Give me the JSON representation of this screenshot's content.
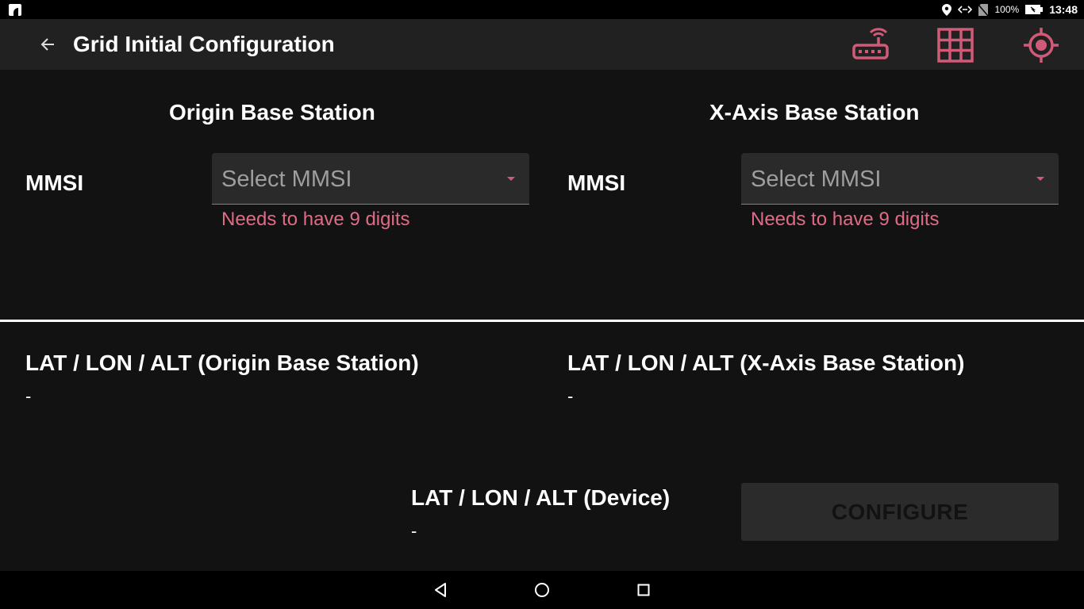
{
  "status_bar": {
    "battery": "100%",
    "time": "13:48",
    "icons": [
      "app-icon",
      "location-icon",
      "data-transfer-icon",
      "no-sim-icon",
      "battery-icon"
    ]
  },
  "app_bar": {
    "title": "Grid Initial Configuration",
    "back_icon": "arrow-left-icon",
    "actions": [
      "router-icon",
      "grid-icon",
      "gps-target-icon"
    ],
    "accent_color": "#d05a78"
  },
  "origin": {
    "section_title": "Origin Base Station",
    "mmsi_label": "MMSI",
    "select_placeholder": "Select MMSI",
    "error": "Needs to have 9 digits"
  },
  "xaxis": {
    "section_title": "X-Axis Base Station",
    "mmsi_label": "MMSI",
    "select_placeholder": "Select MMSI",
    "error": "Needs to have 9 digits"
  },
  "locations": {
    "origin_label": "LAT / LON / ALT (Origin Base Station)",
    "origin_value": "-",
    "xaxis_label": "LAT / LON / ALT (X-Axis Base Station)",
    "xaxis_value": "-",
    "device_label": "LAT / LON / ALT (Device)",
    "device_value": "-"
  },
  "configure_button": {
    "label": "CONFIGURE",
    "enabled": false
  },
  "nav_bar": {
    "buttons": [
      "back-triangle-icon",
      "home-circle-icon",
      "recents-square-icon"
    ]
  }
}
